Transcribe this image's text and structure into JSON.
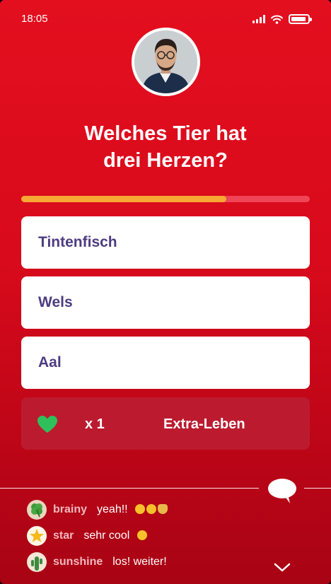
{
  "status": {
    "time": "18:05"
  },
  "question": {
    "line1": "Welches Tier hat",
    "line2": "drei Herzen?"
  },
  "progress": {
    "remaining_fraction": 0.71
  },
  "answers": [
    "Tintenfisch",
    "Wels",
    "Aal"
  ],
  "extra_life": {
    "count": "x 1",
    "label": "Extra-Leben"
  },
  "chat": {
    "messages": [
      {
        "user": "brainy",
        "text": "yeah!!",
        "avatar_icon": "clover-icon",
        "emoji_icons": [
          "money-mouth-emoji-icon",
          "money-mouth-emoji-icon",
          "money-bag-emoji-icon"
        ]
      },
      {
        "user": "star",
        "text": "sehr cool",
        "avatar_icon": "star-icon",
        "emoji_icons": [
          "star-struck-emoji-icon"
        ]
      },
      {
        "user": "sunshine",
        "text": "los! weiter!",
        "avatar_icon": "cactus-icon",
        "emoji_icons": []
      }
    ]
  },
  "colors": {
    "background": "#e30f1f",
    "progress_fill": "#f7a733",
    "answer_text": "#4e3c80",
    "heart": "#2fc05c",
    "username": "#f0b8bd"
  }
}
